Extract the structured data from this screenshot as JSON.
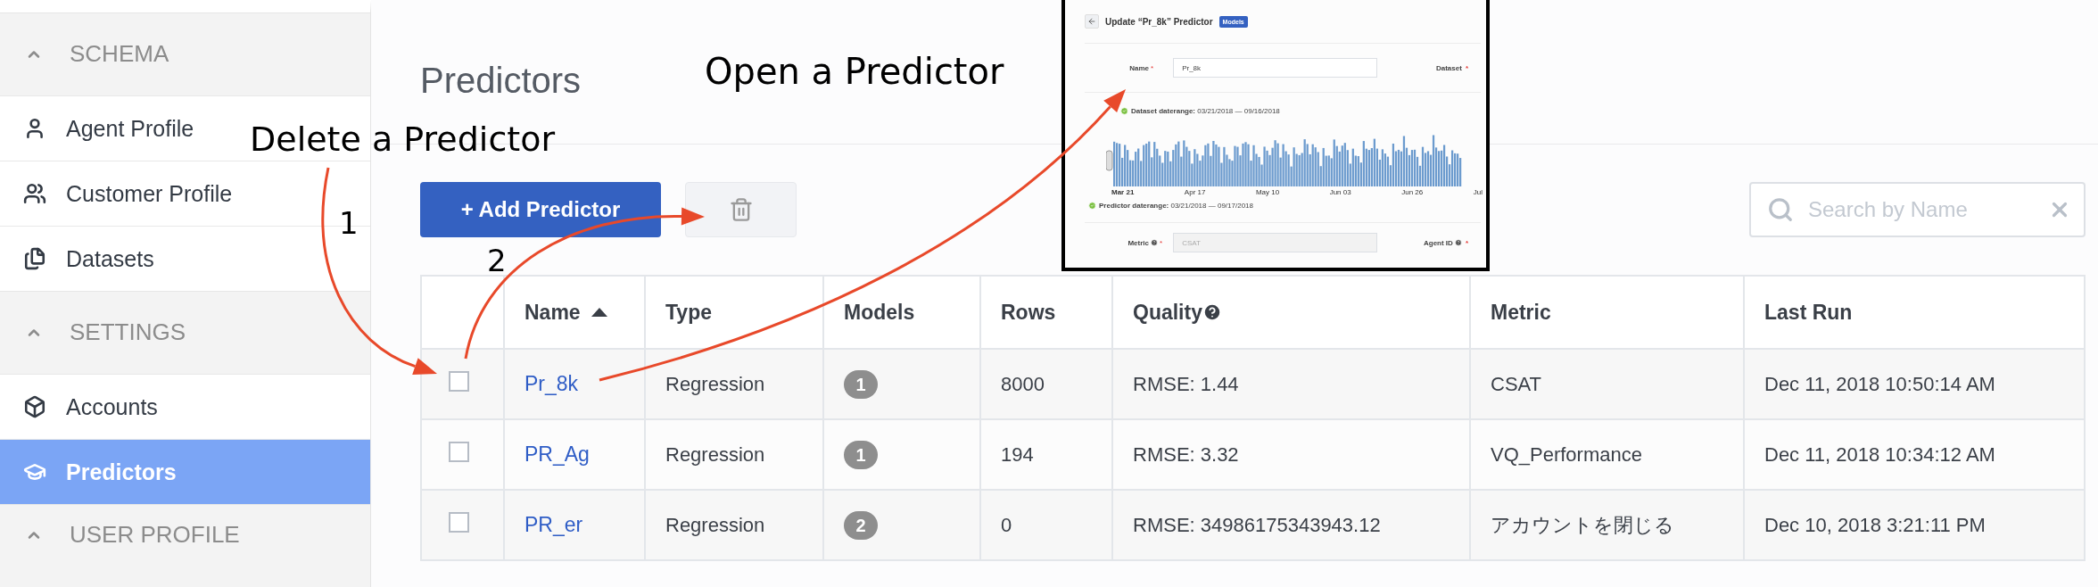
{
  "sidebar": {
    "sections": [
      {
        "title": "SCHEMA",
        "expanded": true,
        "items": [
          {
            "label": "Agent Profile",
            "selected": false
          },
          {
            "label": "Customer Profile",
            "selected": false
          },
          {
            "label": "Datasets",
            "selected": false
          }
        ]
      },
      {
        "title": "SETTINGS",
        "expanded": true,
        "items": [
          {
            "label": "Accounts",
            "selected": false
          },
          {
            "label": "Predictors",
            "selected": true
          }
        ]
      },
      {
        "title": "USER PROFILE",
        "expanded": true
      }
    ]
  },
  "page": {
    "title": "Predictors"
  },
  "toolbar": {
    "add_button": "+ Add Predictor",
    "delete_button": {
      "disabled": true
    },
    "search": {
      "placeholder": "Search by Name"
    }
  },
  "table": {
    "columns": [
      {
        "label": "Name",
        "sorted": true
      },
      {
        "label": "Type"
      },
      {
        "label": "Models"
      },
      {
        "label": "Rows"
      },
      {
        "label": "Quality",
        "help": true
      },
      {
        "label": "Metric"
      },
      {
        "label": "Last Run"
      }
    ],
    "rows": [
      {
        "checked": false,
        "name": "Pr_8k",
        "type": "Regression",
        "models": "1",
        "rows": "8000",
        "quality": "RMSE: 1.44",
        "metric": "CSAT",
        "last_run": "Dec 11, 2018 10:50:14 AM"
      },
      {
        "checked": false,
        "name": "PR_Ag",
        "type": "Regression",
        "models": "1",
        "rows": "194",
        "quality": "RMSE: 3.32",
        "metric": "VQ_Performance",
        "last_run": "Dec 11, 2018 10:34:12 AM"
      },
      {
        "checked": false,
        "name": "PR_er",
        "type": "Regression",
        "models": "2",
        "rows": "0",
        "quality": "RMSE: 34986175343943.12",
        "metric": "アカウントを閉じる",
        "last_run": "Dec 10, 2018 3:21:11 PM"
      }
    ]
  },
  "inset_screenshot": {
    "title": "Update “Pr_8k” Predictor",
    "badge": "Models",
    "name_field": {
      "label": "Name",
      "required": "*",
      "value": "Pr_8k"
    },
    "dataset_field": {
      "label": "Dataset",
      "required": "*"
    },
    "dataset_range": "**Dataset daterange:** 03/21/2018 — 09/16/2018",
    "axis_labels": [
      "Mar 21",
      "Apr 17",
      "May 10",
      "Jun 03",
      "Jun 26",
      "Jul"
    ],
    "predictor_range": "**Predictor daterange:** 03/21/2018 — 09/17/2018",
    "metric_field": {
      "label": "Metric",
      "required": "*",
      "value": "CSAT"
    },
    "agent_field": {
      "label": "Agent ID",
      "required": "*"
    }
  },
  "annotations": [
    {
      "text": "Open a Predictor"
    },
    {
      "text": "Delete a Predictor"
    },
    {
      "text": "1"
    },
    {
      "text": "2"
    }
  ]
}
